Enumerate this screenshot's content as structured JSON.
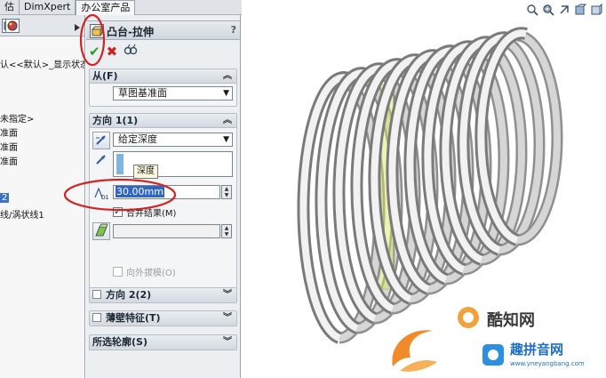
{
  "tabs": [
    "估",
    "DimXpert",
    "办公室产品"
  ],
  "tree": {
    "lines": [
      "认<<默认>_显示状态",
      "未指定>",
      "准面",
      "准面",
      "准面",
      "2",
      "线/涡状线1"
    ]
  },
  "pm": {
    "title": "凸台-拉伸",
    "help": "?",
    "from": {
      "header": "从(F)",
      "value": "草图基准面"
    },
    "direction1": {
      "header": "方向 1(1)",
      "end_condition": "给定深度",
      "tooltip": "深度",
      "depth": "30.00mm",
      "merge_label": "合并结果(M)",
      "draft_label": "向外拔模(O)"
    },
    "direction2": {
      "header": "方向 2(2)"
    },
    "thin": {
      "header": "薄壁特征(T)"
    },
    "contours": {
      "header": "所选轮廓(S)"
    }
  },
  "watermark": {
    "logo_text": "酷知网",
    "site_text": "趣拼音网",
    "site_url": "www.yneyangbang.com"
  },
  "colors": {
    "annotation_red": "#d12424",
    "spring": "#e8e8e8",
    "highlight": "#d9e65a"
  },
  "icons": [
    "zoom-fit-icon",
    "zoom-area-icon",
    "previous-view-icon",
    "section-view-icon",
    "view-orientation-icon"
  ]
}
